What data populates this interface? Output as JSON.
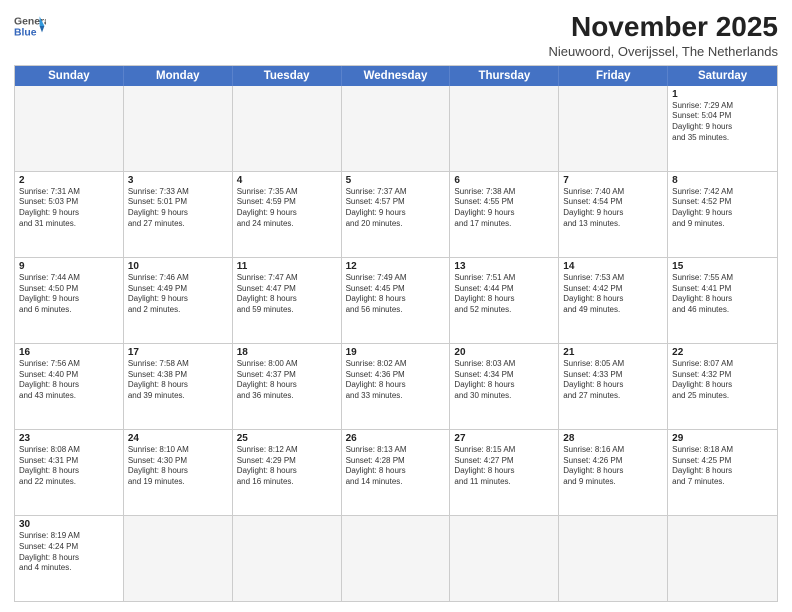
{
  "header": {
    "logo_general": "General",
    "logo_blue": "Blue",
    "month": "November 2025",
    "location": "Nieuwoord, Overijssel, The Netherlands"
  },
  "days_of_week": [
    "Sunday",
    "Monday",
    "Tuesday",
    "Wednesday",
    "Thursday",
    "Friday",
    "Saturday"
  ],
  "rows": [
    [
      {
        "day": "",
        "info": ""
      },
      {
        "day": "",
        "info": ""
      },
      {
        "day": "",
        "info": ""
      },
      {
        "day": "",
        "info": ""
      },
      {
        "day": "",
        "info": ""
      },
      {
        "day": "",
        "info": ""
      },
      {
        "day": "1",
        "info": "Sunrise: 7:29 AM\nSunset: 5:04 PM\nDaylight: 9 hours\nand 35 minutes."
      }
    ],
    [
      {
        "day": "2",
        "info": "Sunrise: 7:31 AM\nSunset: 5:03 PM\nDaylight: 9 hours\nand 31 minutes."
      },
      {
        "day": "3",
        "info": "Sunrise: 7:33 AM\nSunset: 5:01 PM\nDaylight: 9 hours\nand 27 minutes."
      },
      {
        "day": "4",
        "info": "Sunrise: 7:35 AM\nSunset: 4:59 PM\nDaylight: 9 hours\nand 24 minutes."
      },
      {
        "day": "5",
        "info": "Sunrise: 7:37 AM\nSunset: 4:57 PM\nDaylight: 9 hours\nand 20 minutes."
      },
      {
        "day": "6",
        "info": "Sunrise: 7:38 AM\nSunset: 4:55 PM\nDaylight: 9 hours\nand 17 minutes."
      },
      {
        "day": "7",
        "info": "Sunrise: 7:40 AM\nSunset: 4:54 PM\nDaylight: 9 hours\nand 13 minutes."
      },
      {
        "day": "8",
        "info": "Sunrise: 7:42 AM\nSunset: 4:52 PM\nDaylight: 9 hours\nand 9 minutes."
      }
    ],
    [
      {
        "day": "9",
        "info": "Sunrise: 7:44 AM\nSunset: 4:50 PM\nDaylight: 9 hours\nand 6 minutes."
      },
      {
        "day": "10",
        "info": "Sunrise: 7:46 AM\nSunset: 4:49 PM\nDaylight: 9 hours\nand 2 minutes."
      },
      {
        "day": "11",
        "info": "Sunrise: 7:47 AM\nSunset: 4:47 PM\nDaylight: 8 hours\nand 59 minutes."
      },
      {
        "day": "12",
        "info": "Sunrise: 7:49 AM\nSunset: 4:45 PM\nDaylight: 8 hours\nand 56 minutes."
      },
      {
        "day": "13",
        "info": "Sunrise: 7:51 AM\nSunset: 4:44 PM\nDaylight: 8 hours\nand 52 minutes."
      },
      {
        "day": "14",
        "info": "Sunrise: 7:53 AM\nSunset: 4:42 PM\nDaylight: 8 hours\nand 49 minutes."
      },
      {
        "day": "15",
        "info": "Sunrise: 7:55 AM\nSunset: 4:41 PM\nDaylight: 8 hours\nand 46 minutes."
      }
    ],
    [
      {
        "day": "16",
        "info": "Sunrise: 7:56 AM\nSunset: 4:40 PM\nDaylight: 8 hours\nand 43 minutes."
      },
      {
        "day": "17",
        "info": "Sunrise: 7:58 AM\nSunset: 4:38 PM\nDaylight: 8 hours\nand 39 minutes."
      },
      {
        "day": "18",
        "info": "Sunrise: 8:00 AM\nSunset: 4:37 PM\nDaylight: 8 hours\nand 36 minutes."
      },
      {
        "day": "19",
        "info": "Sunrise: 8:02 AM\nSunset: 4:36 PM\nDaylight: 8 hours\nand 33 minutes."
      },
      {
        "day": "20",
        "info": "Sunrise: 8:03 AM\nSunset: 4:34 PM\nDaylight: 8 hours\nand 30 minutes."
      },
      {
        "day": "21",
        "info": "Sunrise: 8:05 AM\nSunset: 4:33 PM\nDaylight: 8 hours\nand 27 minutes."
      },
      {
        "day": "22",
        "info": "Sunrise: 8:07 AM\nSunset: 4:32 PM\nDaylight: 8 hours\nand 25 minutes."
      }
    ],
    [
      {
        "day": "23",
        "info": "Sunrise: 8:08 AM\nSunset: 4:31 PM\nDaylight: 8 hours\nand 22 minutes."
      },
      {
        "day": "24",
        "info": "Sunrise: 8:10 AM\nSunset: 4:30 PM\nDaylight: 8 hours\nand 19 minutes."
      },
      {
        "day": "25",
        "info": "Sunrise: 8:12 AM\nSunset: 4:29 PM\nDaylight: 8 hours\nand 16 minutes."
      },
      {
        "day": "26",
        "info": "Sunrise: 8:13 AM\nSunset: 4:28 PM\nDaylight: 8 hours\nand 14 minutes."
      },
      {
        "day": "27",
        "info": "Sunrise: 8:15 AM\nSunset: 4:27 PM\nDaylight: 8 hours\nand 11 minutes."
      },
      {
        "day": "28",
        "info": "Sunrise: 8:16 AM\nSunset: 4:26 PM\nDaylight: 8 hours\nand 9 minutes."
      },
      {
        "day": "29",
        "info": "Sunrise: 8:18 AM\nSunset: 4:25 PM\nDaylight: 8 hours\nand 7 minutes."
      }
    ],
    [
      {
        "day": "30",
        "info": "Sunrise: 8:19 AM\nSunset: 4:24 PM\nDaylight: 8 hours\nand 4 minutes."
      },
      {
        "day": "",
        "info": ""
      },
      {
        "day": "",
        "info": ""
      },
      {
        "day": "",
        "info": ""
      },
      {
        "day": "",
        "info": ""
      },
      {
        "day": "",
        "info": ""
      },
      {
        "day": "",
        "info": ""
      }
    ]
  ]
}
